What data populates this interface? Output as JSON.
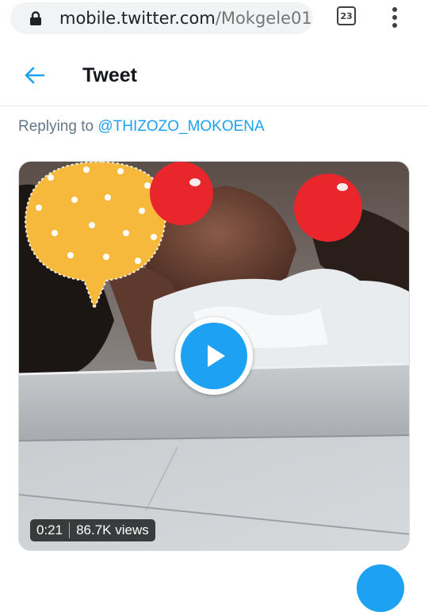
{
  "browser": {
    "url_host": "mobile.twitter.com",
    "url_path": "/Mokgele01",
    "tab_count": "23",
    "icons": [
      "lock-icon",
      "tabs-icon",
      "kebab-menu-icon"
    ]
  },
  "header": {
    "title": "Tweet",
    "back_icon": "arrow-left-icon"
  },
  "reply": {
    "prefix": "Replying to",
    "handle": "@THIZOZO_MOKOENA"
  },
  "video": {
    "duration": "0:21",
    "views": "86.7K views",
    "play_icon": "play-icon"
  },
  "colors": {
    "twitter_blue": "#1da1f2",
    "secondary_text": "#657786",
    "sticker_yellow": "#f6b93b",
    "sticker_red": "#e8262b"
  }
}
